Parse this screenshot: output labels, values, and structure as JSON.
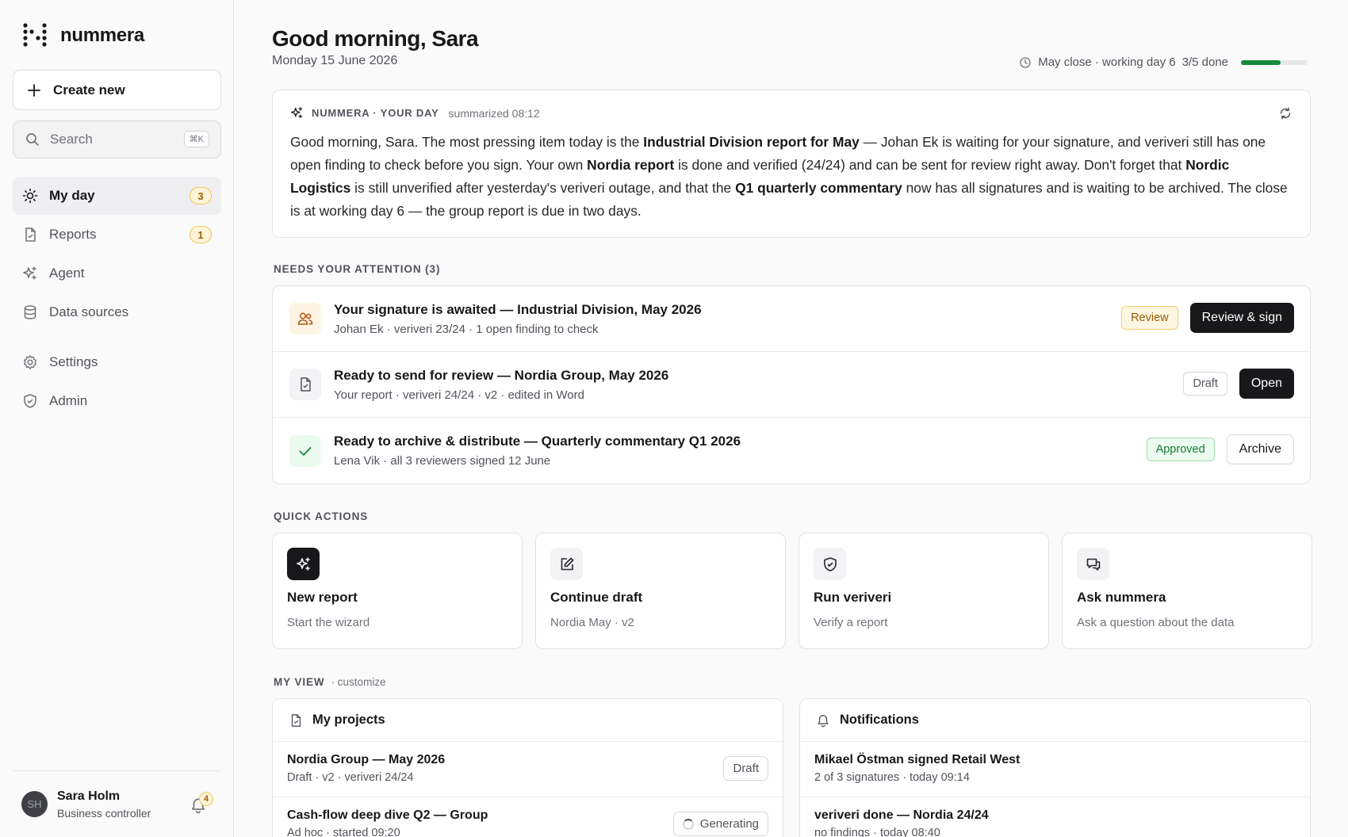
{
  "app": {
    "name": "nummera"
  },
  "sidebar": {
    "create_label": "Create new",
    "search_placeholder": "Search",
    "search_shortcut": "⌘K",
    "items": [
      {
        "label": "My day",
        "badge": "3",
        "icon": "sun-icon",
        "active": true
      },
      {
        "label": "Reports",
        "badge": "1",
        "icon": "file-icon"
      },
      {
        "label": "Agent",
        "icon": "sparkles-icon"
      },
      {
        "label": "Data sources",
        "icon": "database-icon"
      },
      {
        "label": "Settings",
        "icon": "gear-icon"
      },
      {
        "label": "Admin",
        "icon": "shield-icon"
      }
    ],
    "user": {
      "initials": "SH",
      "name": "Sara Holm",
      "role": "Business controller",
      "notifications": "4"
    }
  },
  "header": {
    "greeting": "Good morning, Sara",
    "date": "Monday 15 June 2026",
    "close_status": "May close · working day 6",
    "close_done": "3/5 done",
    "close_progress": 0.6
  },
  "summary": {
    "label": "NUMMERA · YOUR DAY",
    "time": "summarized 08:12",
    "parts": [
      "Good morning, Sara. The most pressing item today is the ",
      "Industrial Division report for May",
      " — Johan Ek is waiting for your signature, and veriveri still has one open finding to check before you sign. Your own ",
      "Nordia report",
      " is done and verified (24/24) and can be sent for review right away. Don't forget that ",
      "Nordic Logistics",
      " is still unverified after yesterday's veriveri outage, and that the ",
      "Q1 quarterly commentary",
      " now has all signatures and is waiting to be archived. The close is at working day 6 — the group report is due in two days."
    ]
  },
  "attention": {
    "label": "NEEDS YOUR ATTENTION (3)",
    "items": [
      {
        "title": "Your signature is awaited — Industrial Division, May 2026",
        "sub": "Johan Ek · veriveri 23/24 · 1 open finding to check",
        "status": "Review",
        "action": "Review & sign"
      },
      {
        "title": "Ready to send for review — Nordia Group, May 2026",
        "sub": "Your report · veriveri 24/24 · v2 · edited in Word",
        "status": "Draft",
        "action": "Open"
      },
      {
        "title": "Ready to archive & distribute — Quarterly commentary Q1 2026",
        "sub": "Lena Vik · all 3 reviewers signed 12 June",
        "status": "Approved",
        "action": "Archive"
      }
    ]
  },
  "quick_actions": {
    "label": "QUICK ACTIONS",
    "items": [
      {
        "title": "New report",
        "sub": "Start the wizard"
      },
      {
        "title": "Continue draft",
        "sub": "Nordia May · v2"
      },
      {
        "title": "Run veriveri",
        "sub": "Verify a report"
      },
      {
        "title": "Ask nummera",
        "sub": "Ask a question about the data"
      }
    ]
  },
  "my_view": {
    "label": "MY VIEW",
    "customize": "· customize",
    "projects": {
      "title": "My projects",
      "rows": [
        {
          "title": "Nordia Group — May 2026",
          "sub": "Draft · v2 · veriveri 24/24",
          "status": "Draft"
        },
        {
          "title": "Cash-flow deep dive Q2 — Group",
          "sub": "Ad hoc · started 09:20",
          "status": "Generating"
        }
      ]
    },
    "notifications": {
      "title": "Notifications",
      "rows": [
        {
          "title": "Mikael Östman signed Retail West",
          "sub": "2 of 3 signatures · today 09:14"
        },
        {
          "title": "veriveri done — Nordia 24/24",
          "sub": "no findings · today 08:40"
        }
      ]
    }
  },
  "colors": {
    "accent_green": "#168a3b",
    "dark": "#18181b",
    "amber": "#f0c555"
  }
}
